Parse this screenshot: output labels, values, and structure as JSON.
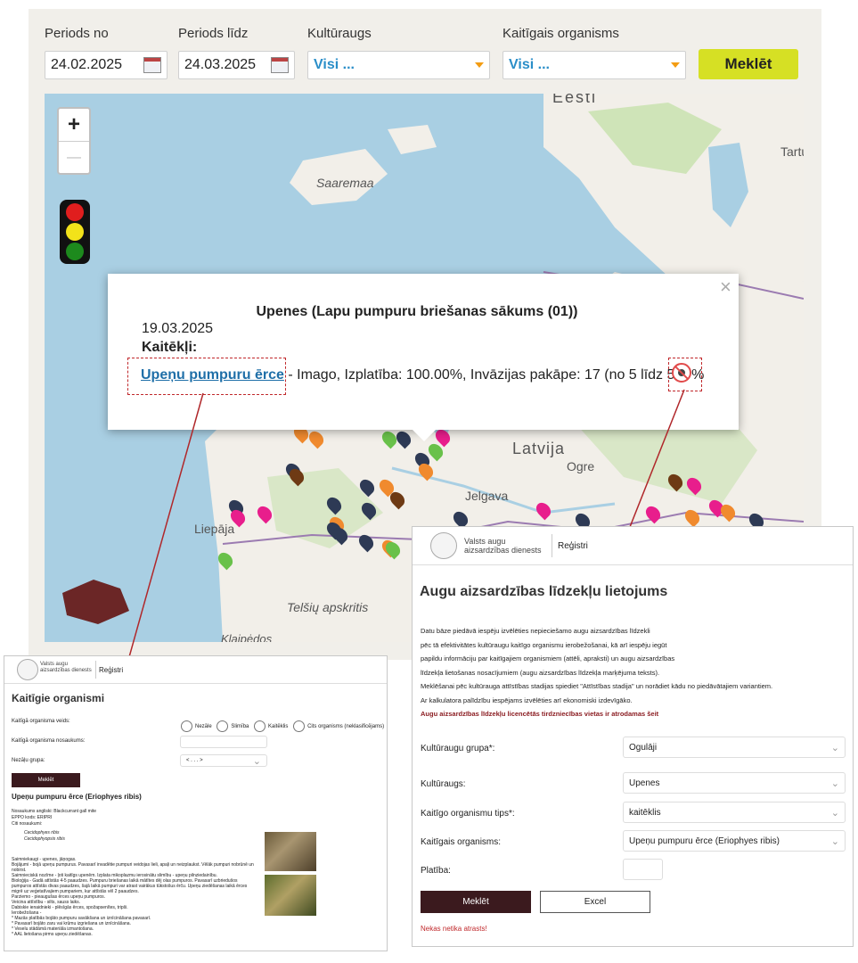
{
  "filters": {
    "period_from_label": "Periods no",
    "period_from_value": "24.02.2025",
    "period_to_label": "Periods līdz",
    "period_to_value": "24.03.2025",
    "crop_label": "Kultūraugs",
    "crop_value": "Visi ...",
    "organism_label": "Kaitīgais organisms",
    "organism_value": "Visi ...",
    "search_label": "Meklēt"
  },
  "map": {
    "zoom_in": "+",
    "zoom_out": "—",
    "labels": {
      "eesti": "Eesti",
      "saaremaa": "Saaremaa",
      "tartu": "Tartu",
      "latvija": "Latvija",
      "ogre": "Ogre",
      "jelgava": "Jelgava",
      "liepaja": "Liepāja",
      "telsiai": "Telšių apskritis",
      "klaipeda": "Klaipėdos"
    },
    "colors": {
      "water": "#a9cfe3",
      "land": "#f2efe9",
      "forest": "#cfe4b8"
    }
  },
  "popup": {
    "close": "×",
    "title": "Upenes (Lapu pumpuru briešanas sākums (01))",
    "date": "19.03.2025",
    "section": "Kaitēkļi:",
    "pest_link": "Upeņu pumpuru ērce",
    "details": " - Imago, Izplatība: 100.00%, Invāzijas pakāpe: 17 (no 5 līdz 50) %"
  },
  "left_shot": {
    "org_name": "Valsts augu aizsardzības dienests",
    "nav": "Reģistri",
    "title": "Kaitīgie organismi",
    "type_label": "Kaitīgā organisma veids:",
    "radios": [
      "Nezāle",
      "Slimība",
      "Kaitēklis",
      "Cits organisms (neklasificējams)"
    ],
    "name_label": "Kaitīgā organisma nosaukums:",
    "group_label": "Nezāļu grupa:",
    "group_value": "< . . . >",
    "search": "Meklēt",
    "result_title": "Upeņu pumpuru ērce (Eriophyes ribis)",
    "lines": [
      "Nosaukums angliski: Blackcurrant gall mite",
      "EPPO kods: ERIPRI",
      "Citi nosaukumi:"
    ],
    "synonyms": [
      "Cecidophyes ribis",
      "Cecidophyopsis ribis"
    ],
    "desc": [
      "Saimniekaugi - upenes, jāņogas.",
      "Bojājumi - bojā upeņu pumpurus. Pavasarī invadētie pumpuri veidojas lieli, apaļi un neizplaukst. Vēlāk pumpuri nobrūnē un nobirst.",
      "Saimnieciskā nozīme - ļoti kaitīgs upenēm. Izplata mikoplazmu ierosinātu slimību - upeņu pilnziedainību.",
      "Bioloģija - Gadā attīstās 4-5 paaudzes. Pumpuru briešanas laikā mātītes dēj olas pumpuros. Pavasarī uzbriedušos pumpuros attīstās divas paaudzes, šajā laikā pumpuri var atrast vairākus tūkstošus ērču. Upeņu ziedēšanas laikā ērces migrē uz veģetatīvajiem pumpariem, kur attīstās vēl 2 paaudzes.",
      "Parziemo - pieaugušas ērces upeņu pumpuros.",
      "Veicina attīstību - silts, sauss laiks.",
      "Dabiskie ienaidnieki - plēsīgās ērces, spožapsenītes, tripši.",
      "Ierobežošana -",
      "* Mazās platībās bojāto pumpuru savākšana un iznīcināšana pavasarī.",
      "* Pavasarī bojāto zaru vai krūmu izgriešana un iznīcināšana.",
      "* Veselu stādāmā materiāla izmantošana.",
      "* AAL lietošana pirms upeņu ziedēšanas."
    ]
  },
  "right_shot": {
    "org_name": "Valsts augu aizsardzības dienests",
    "nav": "Reģistri",
    "title": "Augu aizsardzības līdzekļu lietojums",
    "paragraph": [
      "Datu bāze piedāvā iespēju izvēlēties nepieciešamo augu aizsardzības līdzekli",
      "pēc tā efektivitātes kultūraugu kaitīgo organismu ierobežošanai, kā arī iespēju iegūt",
      "papildu informāciju par kaitīgajiem organismiem (attēli, apraksti) un augu aizsardzības",
      "līdzekļa lietošanas nosacījumiem (augu aizsardzības līdzekļa marķējuma teksts).",
      "Meklēšanai pēc kultūrauga attīstības stadijas spiediet \"Attīstības stadija\" un norādiet kādu no piedāvātajiem variantiem.",
      "Ar kalkulatora palīdzību iespējams izvēlēties arī ekonomiski izdevīgāko."
    ],
    "link": "Augu aizsardzības līdzekļu licencētās tirdzniecības vietas ir atrodamas šeit",
    "fields": [
      {
        "label": "Kultūraugu grupa*:",
        "value": "Ogulāji"
      },
      {
        "label": "Kultūraugs:",
        "value": "Upenes"
      },
      {
        "label": "Kaitīgo organismu tips*:",
        "value": "kaitēklis"
      },
      {
        "label": "Kaitīgais organisms:",
        "value": "Upeņu pumpuru ērce (Eriophyes ribis)"
      }
    ],
    "area_label": "Platība:",
    "search": "Meklēt",
    "excel": "Excel",
    "nothing": "Nekas netika atrasts!"
  }
}
